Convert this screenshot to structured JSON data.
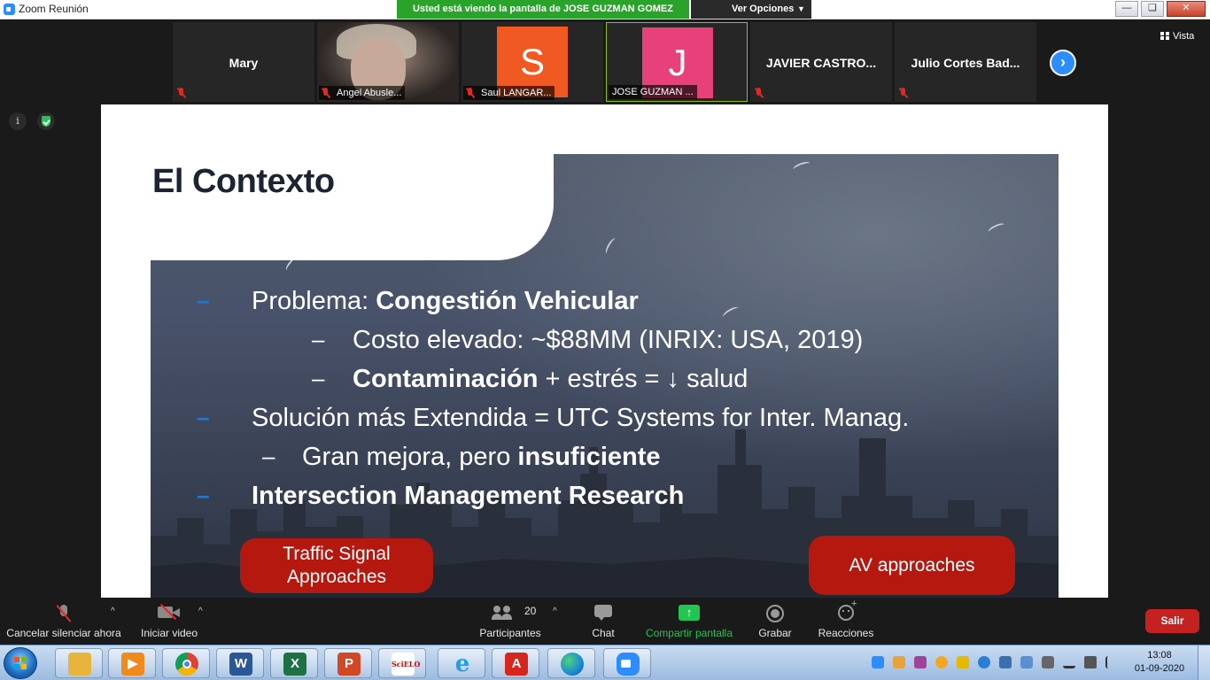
{
  "window": {
    "title": "Zoom Reunión",
    "share_banner": "Usted está viendo la pantalla de JOSE GUZMAN GOMEZ",
    "view_options": "Ver Opciones"
  },
  "gallery": {
    "view_label": "Vista",
    "participants": [
      {
        "name": "Mary",
        "label": "",
        "avatar_letter": "",
        "avatar_color": ""
      },
      {
        "name": "",
        "label": "Angel Abusle...",
        "avatar_letter": "",
        "avatar_color": ""
      },
      {
        "name": "",
        "label": "Saul LANGAR...",
        "avatar_letter": "S",
        "avatar_color": "#f05a22"
      },
      {
        "name": "",
        "label": "JOSE GUZMAN ...",
        "avatar_letter": "J",
        "avatar_color": "#e8407a"
      },
      {
        "name": "JAVIER  CASTRO...",
        "label": "",
        "avatar_letter": "",
        "avatar_color": ""
      },
      {
        "name": "Julio Cortes Bad...",
        "label": "",
        "avatar_letter": "",
        "avatar_color": ""
      }
    ]
  },
  "slide": {
    "title": "El Contexto",
    "lines": {
      "l1_normal": "Problema: ",
      "l1_bold": "Congestión Vehicular",
      "l2": "Costo elevado: ~$88MM (INRIX: USA, 2019)",
      "l3_bold": "Contaminación",
      "l3_normal": " + estrés = ↓ salud",
      "l4": "Solución más Extendida = UTC Systems for Inter. Manag.",
      "l5_normal": "Gran mejora, pero ",
      "l5_bold": "insuficiente",
      "l6_bold": "Intersection Management Research"
    },
    "dash_blue": "–",
    "dash_white": "–",
    "button_left_line1": "Traffic Signal",
    "button_left_line2": "Approaches",
    "button_right": "AV approaches",
    "accent_color": "#b5180f",
    "bullet_color": "#1f78d1"
  },
  "controls": {
    "mute": "Cancelar silenciar ahora",
    "video": "Iniciar video",
    "participants": "Participantes",
    "participants_count": "20",
    "chat": "Chat",
    "share": "Compartir pantalla",
    "record": "Grabar",
    "reactions": "Reacciones",
    "leave": "Salir"
  },
  "taskbar": {
    "apps": [
      {
        "icon": "file-explorer-icon",
        "glyph": "",
        "color": "#e8b53c"
      },
      {
        "icon": "media-player-icon",
        "glyph": "▶",
        "color": "#f08a1c"
      },
      {
        "icon": "chrome-icon",
        "glyph": "",
        "color": "#ffffff"
      },
      {
        "icon": "word-icon",
        "glyph": "W",
        "color": "#2b5797"
      },
      {
        "icon": "excel-icon",
        "glyph": "X",
        "color": "#1e7145"
      },
      {
        "icon": "powerpoint-icon",
        "glyph": "P",
        "color": "#d24726"
      },
      {
        "icon": "scielo-icon",
        "glyph": "SciELO",
        "color": "#ffffff"
      },
      {
        "icon": "internet-explorer-icon",
        "glyph": "e",
        "color": "#1ea0e6"
      },
      {
        "icon": "acrobat-icon",
        "glyph": "A",
        "color": "#d7261e"
      },
      {
        "icon": "edge-icon",
        "glyph": "",
        "color": "#1a8ad4"
      },
      {
        "icon": "zoom-icon",
        "glyph": "",
        "color": "#2d8cff"
      }
    ],
    "time": "13:08",
    "date": "01-09-2020"
  }
}
